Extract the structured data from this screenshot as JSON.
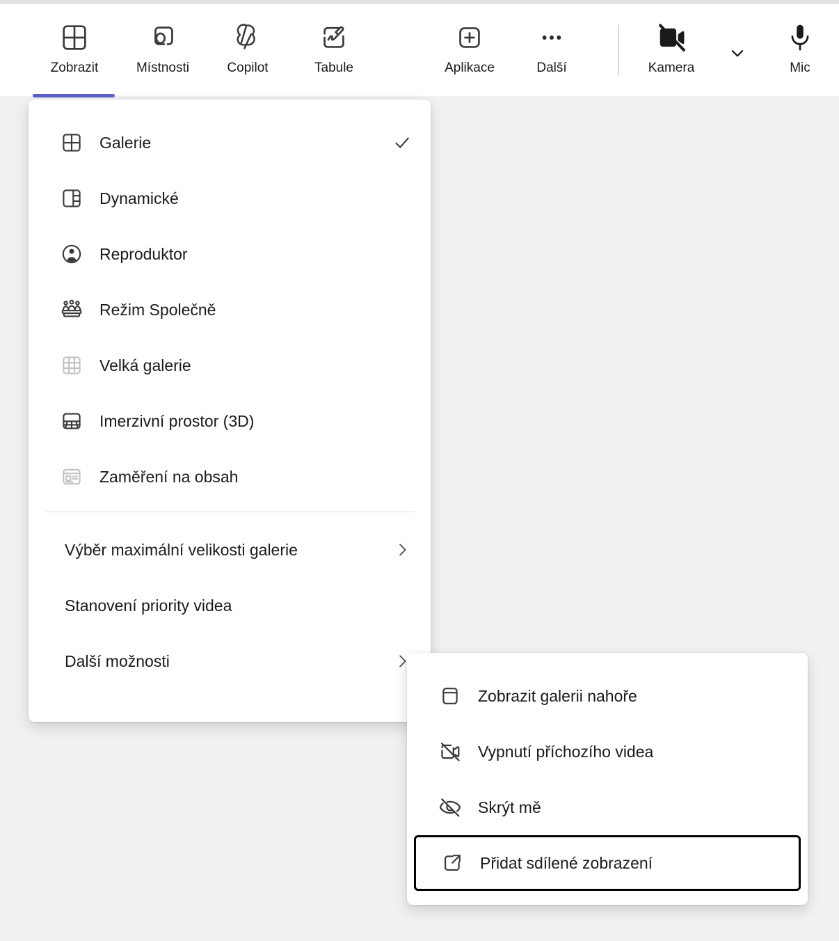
{
  "app": {
    "name": "Microsoft Teams meeting toolbar",
    "accent_color": "#5B5FC7"
  },
  "toolbar": {
    "items": [
      {
        "label": "Zobrazit",
        "icon": "gallery-grid-icon",
        "active": true
      },
      {
        "label": "Místnosti",
        "icon": "breakout-rooms-icon",
        "active": false
      },
      {
        "label": "Copilot",
        "icon": "copilot-icon",
        "active": false
      },
      {
        "label": "Tabule",
        "icon": "whiteboard-icon",
        "active": false
      },
      {
        "label": "Aplikace",
        "icon": "plus-box-icon",
        "active": false
      },
      {
        "label": "Další",
        "icon": "more-ellipsis-icon",
        "active": false
      },
      {
        "label": "Kamera",
        "icon": "camera-off-icon",
        "active": false
      },
      {
        "label": "Mic",
        "icon": "microphone-icon",
        "active": false
      }
    ],
    "camera_dropdown_icon": "chevron-down-icon",
    "separator": "vertical-divider"
  },
  "main_menu": {
    "layout_items": [
      {
        "label": "Galerie",
        "icon": "gallery-grid-icon",
        "checked": true,
        "disabled": false
      },
      {
        "label": "Dynamické",
        "icon": "dynamic-layout-icon",
        "checked": false,
        "disabled": false
      },
      {
        "label": "Reproduktor",
        "icon": "speaker-person-icon",
        "checked": false,
        "disabled": false
      },
      {
        "label": "Režim Společně",
        "icon": "together-mode-icon",
        "checked": false,
        "disabled": false
      },
      {
        "label": "Velká galerie",
        "icon": "large-gallery-icon",
        "checked": false,
        "disabled": true
      },
      {
        "label": "Imerzivní prostor (3D)",
        "icon": "immersive-space-icon",
        "checked": false,
        "disabled": false
      },
      {
        "label": "Zaměření na obsah",
        "icon": "content-focus-icon",
        "checked": false,
        "disabled": true
      }
    ],
    "option_items": [
      {
        "label": "Výběr maximální velikosti galerie",
        "submenu": true
      },
      {
        "label": "Stanovení priority videa",
        "submenu": false
      },
      {
        "label": "Další možnosti",
        "submenu": true
      }
    ],
    "check_icon": "checkmark-icon",
    "submenu_icon": "chevron-right-icon"
  },
  "sub_menu": {
    "items": [
      {
        "label": "Zobrazit galerii nahoře",
        "icon": "gallery-top-icon",
        "focused": false
      },
      {
        "label": "Vypnutí příchozího videa",
        "icon": "video-off-icon",
        "focused": false
      },
      {
        "label": "Skrýt mě",
        "icon": "eye-off-icon",
        "focused": false
      },
      {
        "label": "Přidat sdílené zobrazení",
        "icon": "open-external-icon",
        "focused": true
      }
    ]
  }
}
